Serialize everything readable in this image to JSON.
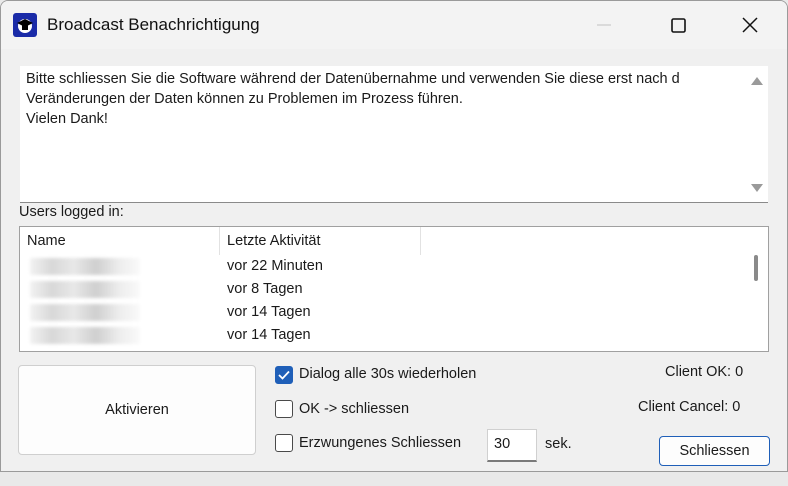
{
  "window": {
    "title": "Broadcast Benachrichtigung"
  },
  "message": {
    "text": "Bitte schliessen Sie die Software während der Datenübernahme und verwenden Sie diese erst nach d\nVeränderungen der Daten können zu Problemen im Prozess führen.\nVielen Dank!"
  },
  "users": {
    "label": "Users logged in:",
    "columns": [
      "Name",
      "Letzte Aktivität"
    ],
    "rows": [
      {
        "activity": "vor 22 Minuten"
      },
      {
        "activity": "vor 8 Tagen"
      },
      {
        "activity": "vor 14 Tagen"
      },
      {
        "activity": "vor 14 Tagen"
      }
    ]
  },
  "controls": {
    "activate_label": "Aktivieren",
    "repeat_label": "Dialog alle 30s wiederholen",
    "repeat_checked": true,
    "ok_close_label": "OK -> schliessen",
    "ok_close_checked": false,
    "force_close_label": "Erzwungenes Schliessen",
    "force_close_checked": false,
    "force_seconds": "30",
    "seconds_unit": "sek.",
    "client_ok": "Client OK: 0",
    "client_cancel": "Client Cancel: 0",
    "close_label": "Schliessen"
  },
  "colors": {
    "accent": "#1f5fb8",
    "icon_bg": "#1a2ba8"
  },
  "icons": [
    "app-icon",
    "minimize-icon",
    "maximize-icon",
    "close-icon",
    "scroll-up-icon",
    "scroll-down-icon",
    "checkmark-icon"
  ]
}
